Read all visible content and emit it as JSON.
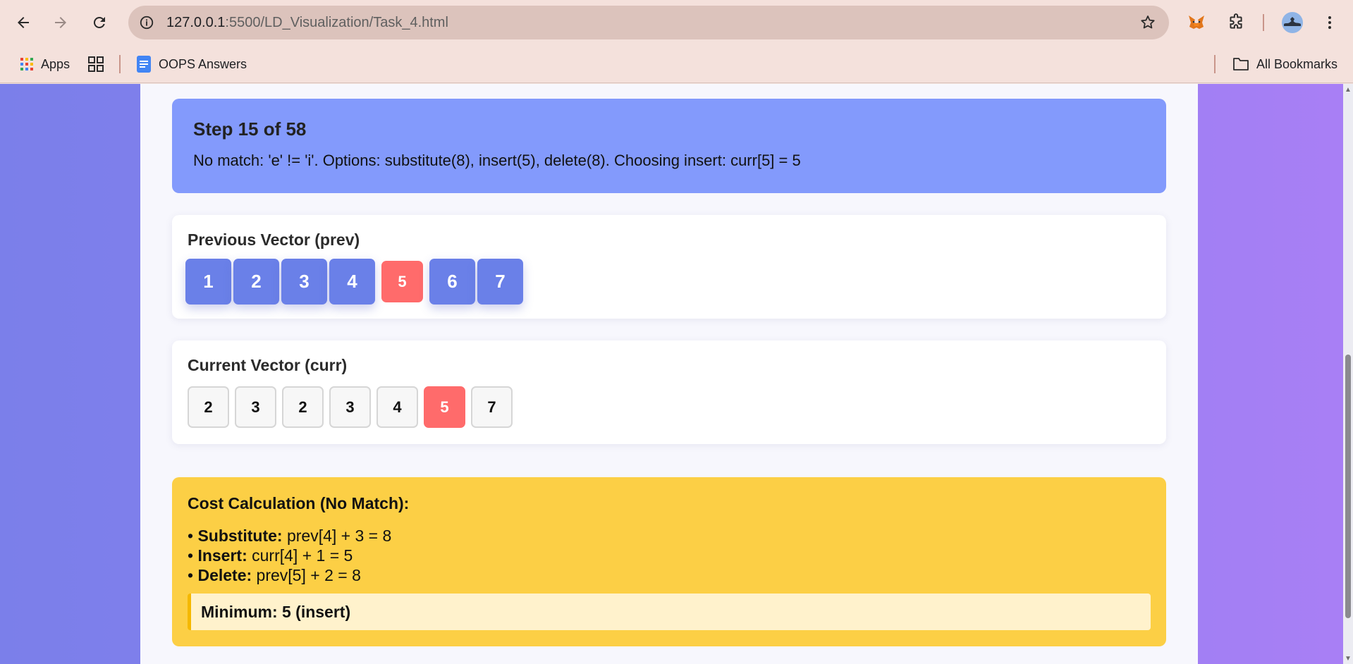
{
  "browser": {
    "url_host": "127.0.0.1",
    "url_rest": ":5500/LD_Visualization/Task_4.html",
    "bookmarks": {
      "apps": "Apps",
      "oops": "OOPS Answers",
      "all": "All Bookmarks"
    }
  },
  "step": {
    "title": "Step 15 of 58",
    "description": "No match: 'e' != 'i'. Options: substitute(8), insert(5), delete(8). Choosing insert: curr[5] = 5"
  },
  "prev_vector": {
    "title": "Previous Vector (prev)",
    "cells": [
      "1",
      "2",
      "3",
      "4",
      "5",
      "6",
      "7"
    ],
    "highlight_index": 4
  },
  "curr_vector": {
    "title": "Current Vector (curr)",
    "cells": [
      "2",
      "3",
      "2",
      "3",
      "4",
      "5",
      "7"
    ],
    "highlight_index": 5
  },
  "cost": {
    "title": "Cost Calculation (No Match):",
    "bullet": "•",
    "items": [
      {
        "label": "Substitute:",
        "expr": "prev[4] + 3 = 8"
      },
      {
        "label": "Insert:",
        "expr": "curr[4] + 1 = 5"
      },
      {
        "label": "Delete:",
        "expr": "prev[5] + 2 = 8"
      }
    ],
    "minimum": "Minimum: 5 (insert)"
  },
  "colors": {
    "step_bg": "#839afc",
    "prev_cell": "#6a80e8",
    "highlight": "#ff6b6b",
    "cost_bg": "#fccf45"
  }
}
